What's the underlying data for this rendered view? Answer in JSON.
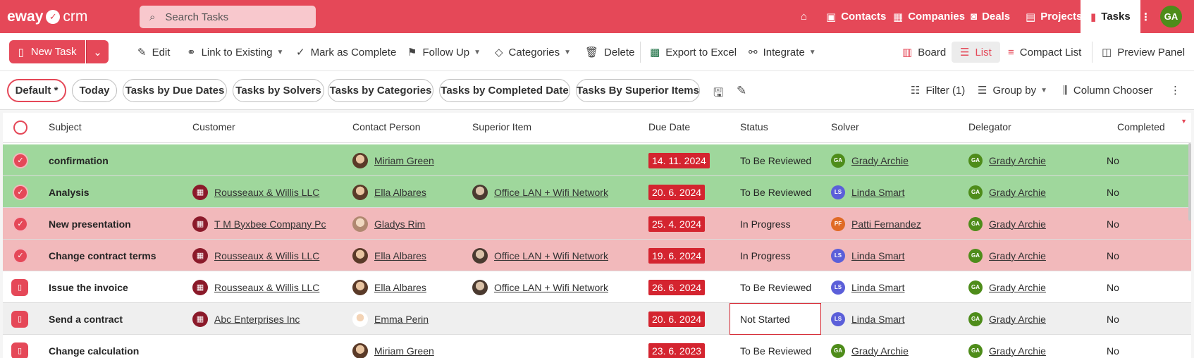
{
  "app": {
    "logo_left": "eway",
    "logo_right": "crm",
    "search_placeholder": "Search Tasks",
    "nav": [
      {
        "label": "Contacts"
      },
      {
        "label": "Companies"
      },
      {
        "label": "Deals"
      },
      {
        "label": "Projects"
      },
      {
        "label": "Tasks"
      }
    ],
    "user_initials": "GA",
    "accent_color": "#e54858"
  },
  "toolbar": {
    "new_task": "New Task",
    "edit": "Edit",
    "link_existing": "Link to Existing",
    "mark_complete": "Mark as Complete",
    "follow_up": "Follow Up",
    "categories": "Categories",
    "delete": "Delete",
    "export_excel": "Export to Excel",
    "integrate": "Integrate",
    "board": "Board",
    "list": "List",
    "compact_list": "Compact List",
    "preview_panel": "Preview Panel"
  },
  "views": {
    "chips": [
      "Default *",
      "Today",
      "Tasks by Due Dates",
      "Tasks by Solvers",
      "Tasks by Categories",
      "Tasks by Completed Date",
      "Tasks By Superior Items"
    ],
    "filter": "Filter (1)",
    "group_by": "Group by",
    "column_chooser": "Column Chooser"
  },
  "table": {
    "columns": [
      "Subject",
      "Customer",
      "Contact Person",
      "Superior Item",
      "Due Date",
      "Status",
      "Solver",
      "Delegator",
      "Completed"
    ],
    "rows": [
      {
        "subject": "confirmation",
        "customer": "",
        "contact": "Miriam Green",
        "superior": "",
        "due": "14. 11. 2024",
        "status": "To Be Reviewed",
        "solver_initials": "GA",
        "solver": "Grady Archie",
        "delegator_initials": "GA",
        "delegator": "Grady Archie",
        "completed": "No"
      },
      {
        "subject": "Analysis",
        "customer": "Rousseaux & Willis LLC",
        "contact": "Ella Albares",
        "superior": "Office LAN + Wifi Network",
        "due": "20. 6. 2024",
        "status": "To Be Reviewed",
        "solver_initials": "LS",
        "solver": "Linda Smart",
        "delegator_initials": "GA",
        "delegator": "Grady Archie",
        "completed": "No"
      },
      {
        "subject": "New presentation",
        "customer": "T M Byxbee Company Pc",
        "contact": "Gladys Rim",
        "superior": "",
        "due": "25. 4. 2024",
        "status": "In Progress",
        "solver_initials": "PF",
        "solver": "Patti Fernandez",
        "delegator_initials": "GA",
        "delegator": "Grady Archie",
        "completed": "No"
      },
      {
        "subject": "Change contract terms",
        "customer": "Rousseaux & Willis LLC",
        "contact": "Ella Albares",
        "superior": "Office LAN + Wifi Network",
        "due": "19. 6. 2024",
        "status": "In Progress",
        "solver_initials": "LS",
        "solver": "Linda Smart",
        "delegator_initials": "GA",
        "delegator": "Grady Archie",
        "completed": "No"
      },
      {
        "subject": "Issue the invoice",
        "customer": "Rousseaux & Willis LLC",
        "contact": "Ella Albares",
        "superior": "Office LAN + Wifi Network",
        "due": "26. 6. 2024",
        "status": "To Be Reviewed",
        "solver_initials": "LS",
        "solver": "Linda Smart",
        "delegator_initials": "GA",
        "delegator": "Grady Archie",
        "completed": "No"
      },
      {
        "subject": "Send a contract",
        "customer": "Abc Enterprises Inc",
        "contact": "Emma Perin",
        "superior": "",
        "due": "20. 6. 2024",
        "status": "Not Started",
        "solver_initials": "LS",
        "solver": "Linda Smart",
        "delegator_initials": "GA",
        "delegator": "Grady Archie",
        "completed": "No"
      },
      {
        "subject": "Change calculation",
        "customer": "",
        "contact": "Miriam Green",
        "superior": "",
        "due": "23. 6. 2023",
        "status": "To Be Reviewed",
        "solver_initials": "GA",
        "solver": "Grady Archie",
        "delegator_initials": "GA",
        "delegator": "Grady Archie",
        "completed": "No"
      }
    ]
  }
}
